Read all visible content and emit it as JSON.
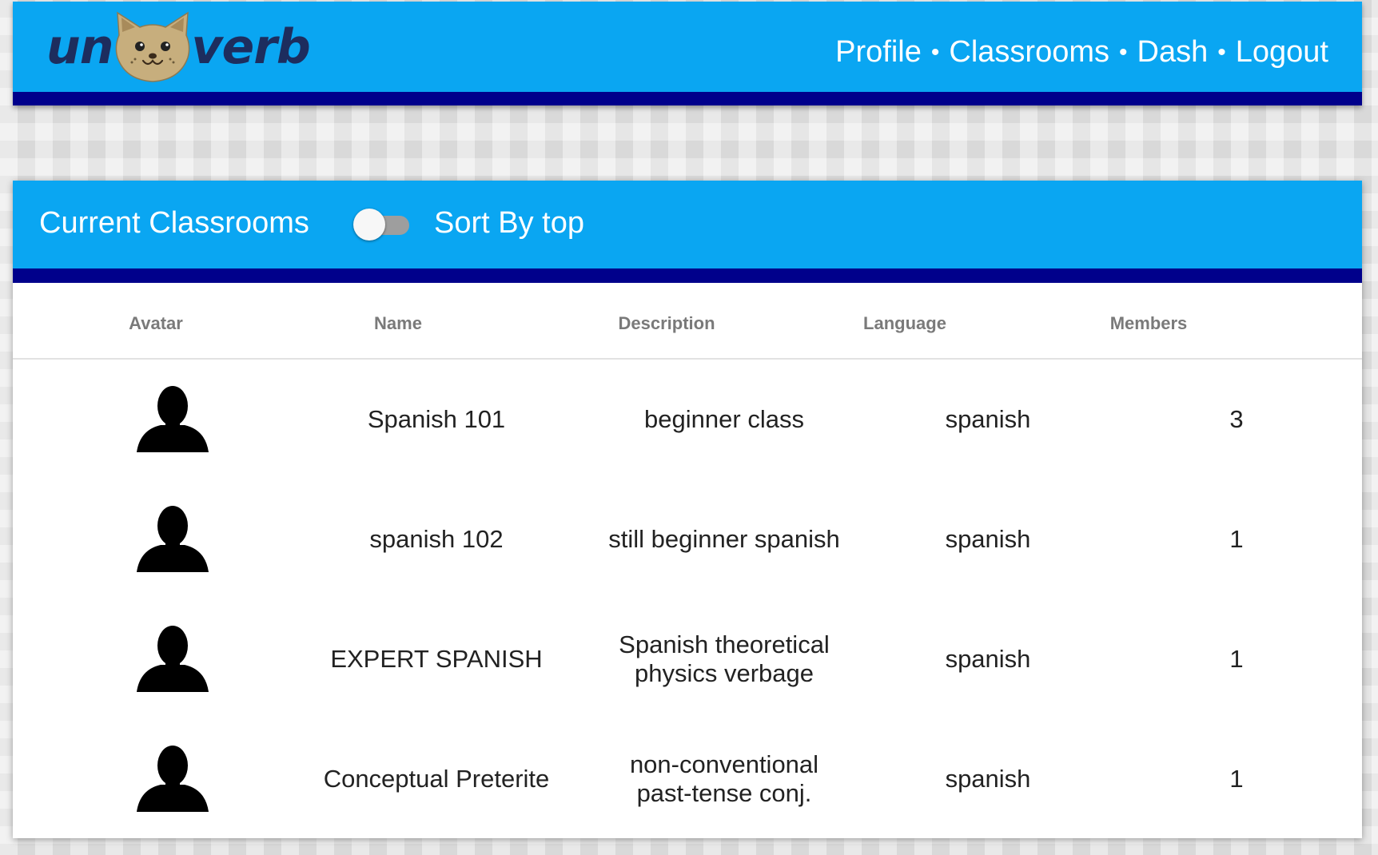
{
  "brand": {
    "logo_left": "un",
    "logo_right": "verb",
    "logo_icon": "cat-face-icon"
  },
  "nav": {
    "items": [
      "Profile",
      "Classrooms",
      "Dash",
      "Logout"
    ],
    "separator": "•"
  },
  "classrooms": {
    "title": "Current Classrooms",
    "sort_label": "Sort By top",
    "sort_toggle_on": false,
    "columns": [
      "Avatar",
      "Name",
      "Description",
      "Language",
      "Members"
    ],
    "rows": [
      {
        "avatar_icon": "person-silhouette-icon",
        "name": "Spanish 101",
        "description": "beginner class",
        "language": "spanish",
        "members": "3"
      },
      {
        "avatar_icon": "person-silhouette-icon",
        "name": "spanish 102",
        "description": "still beginner spanish",
        "language": "spanish",
        "members": "1"
      },
      {
        "avatar_icon": "person-silhouette-icon",
        "name": "EXPERT SPANISH",
        "description": "Spanish theoretical physics verbage",
        "language": "spanish",
        "members": "1"
      },
      {
        "avatar_icon": "person-silhouette-icon",
        "name": "Conceptual Preterite",
        "description": "non-conventional past-tense conj.",
        "language": "spanish",
        "members": "1"
      }
    ]
  },
  "colors": {
    "primary_blue": "#0aa6f2",
    "accent_navy": "#00008b",
    "logo_text": "#1d2d5e"
  }
}
